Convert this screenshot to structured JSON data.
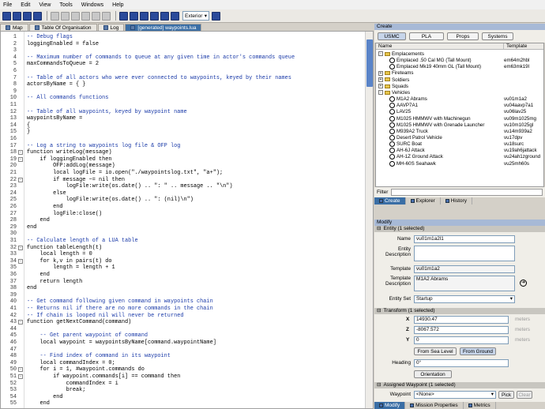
{
  "menu": [
    "File",
    "Edit",
    "View",
    "Tools",
    "Windows",
    "Help"
  ],
  "toolbar": {
    "view_dropdown": "Exterior"
  },
  "tabs": [
    {
      "label": "Map",
      "active": false
    },
    {
      "label": "Table Of Organisation",
      "active": false
    },
    {
      "label": "Log",
      "active": false
    },
    {
      "label": "[generated] waypoints.lua",
      "active": true
    }
  ],
  "code": [
    {
      "n": "1",
      "t": "-- Debug flags",
      "c": "com"
    },
    {
      "n": "2",
      "t": "loggingEnabled = false"
    },
    {
      "n": "3",
      "t": ""
    },
    {
      "n": "4",
      "t": "-- Maximum number of commands to queue at any given time in actor's commands queue",
      "c": "com"
    },
    {
      "n": "5",
      "t": "maxCommandsToQueue = 2"
    },
    {
      "n": "6",
      "t": ""
    },
    {
      "n": "7",
      "t": "-- Table of all actors who were ever connected to waypoints, keyed by their names",
      "c": "com"
    },
    {
      "n": "8",
      "t": "actorsByName = { }"
    },
    {
      "n": "9",
      "t": ""
    },
    {
      "n": "10",
      "t": "-- All commands functions",
      "c": "com"
    },
    {
      "n": "11",
      "t": ""
    },
    {
      "n": "12",
      "t": "-- Table of all waypoints, keyed by waypoint name",
      "c": "com"
    },
    {
      "n": "13",
      "t": "waypointsByName ="
    },
    {
      "n": "14",
      "t": "{"
    },
    {
      "n": "15",
      "t": "}"
    },
    {
      "n": "16",
      "t": ""
    },
    {
      "n": "17",
      "t": "-- Log a string to waypoints log file & OFP log",
      "c": "com"
    },
    {
      "n": "18",
      "t": "function writeLog(message)",
      "f": "-"
    },
    {
      "n": "19",
      "t": "    if loggingEnabled then",
      "f": "-"
    },
    {
      "n": "20",
      "t": "        OFP:addLog(message)"
    },
    {
      "n": "21",
      "t": "        local logFile = io.open(\"./waypointslog.txt\", \"a+\");"
    },
    {
      "n": "22",
      "t": "        if message ~= nil then",
      "f": "-"
    },
    {
      "n": "23",
      "t": "            logFile:write(os.date() .. \": \" .. message .. \"\\n\")"
    },
    {
      "n": "24",
      "t": "        else"
    },
    {
      "n": "25",
      "t": "            logFile:write(os.date() .. \": (nil)\\n\")"
    },
    {
      "n": "26",
      "t": "        end"
    },
    {
      "n": "27",
      "t": "        logFile:close()"
    },
    {
      "n": "28",
      "t": "    end"
    },
    {
      "n": "29",
      "t": "end"
    },
    {
      "n": "30",
      "t": ""
    },
    {
      "n": "31",
      "t": "-- Calculate length of a LUA table",
      "c": "com"
    },
    {
      "n": "32",
      "t": "function tableLength(t)",
      "f": "-"
    },
    {
      "n": "33",
      "t": "    local length = 0"
    },
    {
      "n": "34",
      "t": "    for k,v in pairs(t) do",
      "f": "-"
    },
    {
      "n": "35",
      "t": "        length = length + 1"
    },
    {
      "n": "36",
      "t": "    end"
    },
    {
      "n": "37",
      "t": "    return length"
    },
    {
      "n": "38",
      "t": "end"
    },
    {
      "n": "39",
      "t": ""
    },
    {
      "n": "40",
      "t": "-- Get command following given command in waypoints chain",
      "c": "com"
    },
    {
      "n": "41",
      "t": "-- Returns nil if there are no more commands in the chain",
      "c": "com"
    },
    {
      "n": "42",
      "t": "-- If chain is looped nil will never be returned",
      "c": "com"
    },
    {
      "n": "43",
      "t": "function getNextCommand(command)",
      "f": "-"
    },
    {
      "n": "44",
      "t": ""
    },
    {
      "n": "45",
      "t": "    -- Get parent waypoint of command",
      "c": "com"
    },
    {
      "n": "46",
      "t": "    local waypoint = waypointsByName[command.waypointName]"
    },
    {
      "n": "47",
      "t": ""
    },
    {
      "n": "48",
      "t": "    -- Find index of command in its waypoint",
      "c": "com"
    },
    {
      "n": "49",
      "t": "    local commandIndex = 0;"
    },
    {
      "n": "50",
      "t": "    for i = 1, #waypoint.commands do",
      "f": "-"
    },
    {
      "n": "51",
      "t": "        if waypoint.commands[i] == command then",
      "f": "-"
    },
    {
      "n": "52",
      "t": "            commandIndex = i"
    },
    {
      "n": "53",
      "t": "            break;"
    },
    {
      "n": "54",
      "t": "        end"
    },
    {
      "n": "55",
      "t": "    end"
    }
  ],
  "create": {
    "title": "Create",
    "faction_tabs": [
      "USMC",
      "PLA",
      "Props",
      "Systems"
    ],
    "columns": [
      "Name",
      "Template"
    ],
    "tree": [
      {
        "label": "Emplacements",
        "depth": 0,
        "exp": "-",
        "type": "folder",
        "tpl": ""
      },
      {
        "label": "Emplaced .50 Cal MG (Tall Mount)",
        "depth": 1,
        "type": "unit",
        "tpl": "em64m2hbl"
      },
      {
        "label": "Emplaced Mk19 40mm GL (Tall Mount)",
        "depth": 1,
        "type": "unit",
        "tpl": "em63mk19l"
      },
      {
        "label": "Fireteams",
        "depth": 0,
        "exp": "+",
        "type": "folder",
        "tpl": ""
      },
      {
        "label": "Soldiers",
        "depth": 0,
        "exp": "+",
        "type": "folder",
        "tpl": ""
      },
      {
        "label": "Squads",
        "depth": 0,
        "exp": "+",
        "type": "folder",
        "tpl": ""
      },
      {
        "label": "Vehicles",
        "depth": 0,
        "exp": "-",
        "type": "folder",
        "tpl": ""
      },
      {
        "label": "M1A2 Abrams",
        "depth": 1,
        "type": "unit",
        "tpl": "vu01m1a2"
      },
      {
        "label": "AAVP7A1",
        "depth": 1,
        "type": "unit",
        "tpl": "vu04aavp7a1"
      },
      {
        "label": "LAV25",
        "depth": 1,
        "type": "unit",
        "tpl": "vu06lav25"
      },
      {
        "label": "M1025 HMMWV with Machinegun",
        "depth": 1,
        "type": "unit",
        "tpl": "vu09m1025mg"
      },
      {
        "label": "M1025 HMMWV with Grenade Launcher",
        "depth": 1,
        "type": "unit",
        "tpl": "vu10m1025gl"
      },
      {
        "label": "M939A2 Truck",
        "depth": 1,
        "type": "unit",
        "tpl": "vu14m939a2"
      },
      {
        "label": "Desert Patrol Vehicle",
        "depth": 1,
        "type": "unit",
        "tpl": "vu17dpv"
      },
      {
        "label": "SURC Boat",
        "depth": 1,
        "type": "unit",
        "tpl": "vu18surc"
      },
      {
        "label": "AH-6J Attack",
        "depth": 1,
        "type": "unit",
        "tpl": "vu19ah6jattack"
      },
      {
        "label": "AH-1Z Ground Attack",
        "depth": 1,
        "type": "unit",
        "tpl": "vu24ah1zground"
      },
      {
        "label": "MH-60S Seahawk",
        "depth": 1,
        "type": "unit",
        "tpl": "vu25mh60s"
      }
    ],
    "filter_label": "Filter",
    "bottom_tabs": [
      "Create",
      "Explorer",
      "History"
    ]
  },
  "modify": {
    "title": "Modify",
    "entity_section": "Entity (1 selected)",
    "name_label": "Name",
    "name": "vu01m1a2l1",
    "entity_desc_label": "Entity Description",
    "template_label": "Template",
    "template": "vu01m1a2",
    "template_desc_label": "Template Description",
    "template_desc": "M1A2 Abrams",
    "entity_set_label": "Entity Set",
    "entity_set": "Startup",
    "transform_section": "Transform (1 selected)",
    "x_value": "14930.47",
    "z_value": "-8067.572",
    "y_value": "0",
    "x_label": "X",
    "z_label": "Z",
    "y_label": "Y",
    "unit": "meters",
    "from_sea_level": "From Sea Level",
    "from_ground": "From Ground",
    "heading_label": "Heading",
    "heading": "0°",
    "orientation": "Orientation",
    "waypoint_section": "Assigned Waypoint (1 selected)",
    "waypoint_label": "Waypoint",
    "waypoint": "<None>",
    "pick": "Pick",
    "clear": "Clear",
    "bottom_tabs": [
      "Modify",
      "Mission Properties",
      "Metrics"
    ]
  }
}
